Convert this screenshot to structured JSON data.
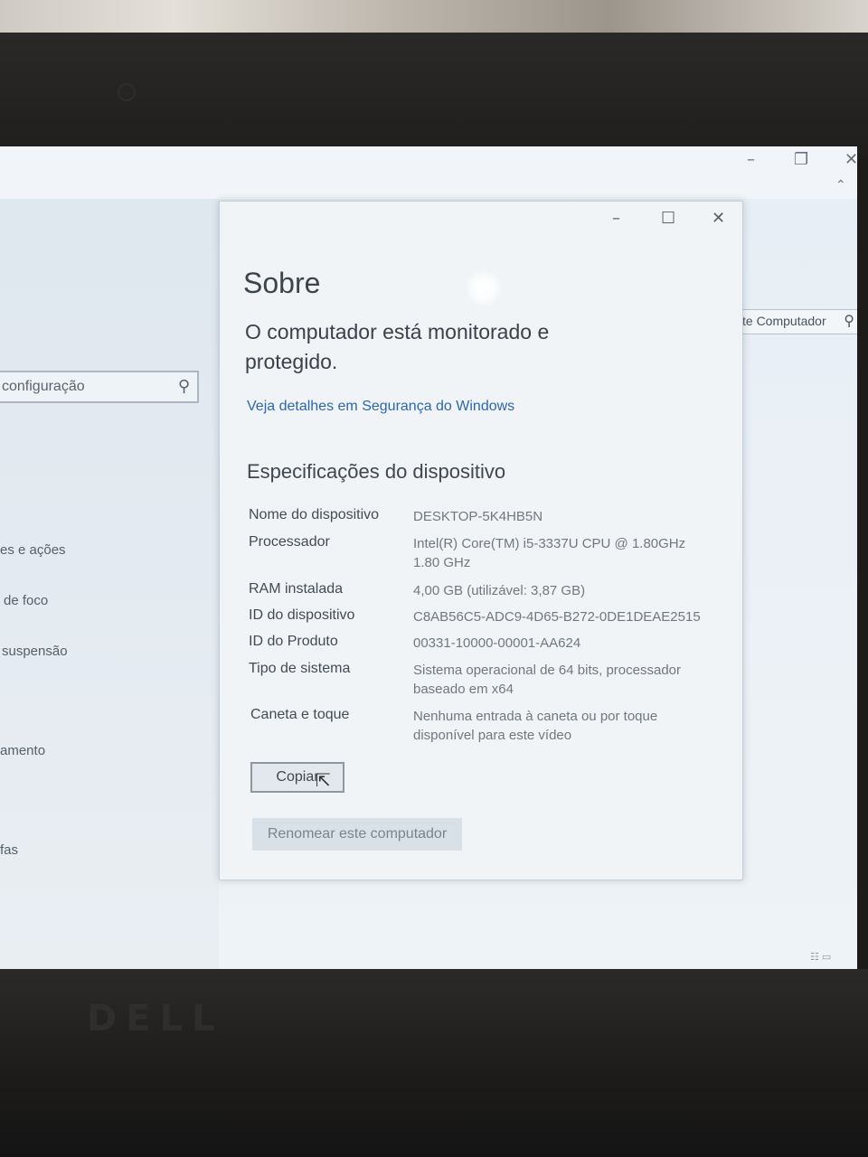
{
  "dialog": {
    "title": "Sobre",
    "protection_status": "O computador está monitorado e protegido.",
    "security_link": "Veja detalhes em Segurança do Windows",
    "section_title": "Especificações do dispositivo",
    "specs": [
      {
        "label": "Nome do dispositivo",
        "value": "DESKTOP-5K4HB5N"
      },
      {
        "label": "Processador",
        "value": "Intel(R) Core(TM) i5-3337U CPU @ 1.80GHz 1.80 GHz"
      },
      {
        "label": "RAM instalada",
        "value": "4,00 GB (utilizável: 3,87 GB)"
      },
      {
        "label": "ID do dispositivo",
        "value": "C8AB56C5-ADC9-4D65-B272-0DE1DEAE2515"
      },
      {
        "label": "ID do Produto",
        "value": "00331-10000-00001-AA624"
      },
      {
        "label": "Tipo de sistema",
        "value": "Sistema operacional de 64 bits, processador baseado em x64"
      },
      {
        "label": "Caneta e toque",
        "value": "Nenhuma entrada à caneta ou por toque disponível para este vídeo"
      }
    ],
    "copy_button": "Copiar",
    "rename_button": "Renomear este computador",
    "controls": {
      "minimize": "–",
      "maximize": "☐",
      "close": "✕"
    }
  },
  "settings_window": {
    "search_placeholder": "configuração",
    "nav_items": [
      "es e ações",
      "de foco",
      "suspensão",
      "amento",
      "fas"
    ],
    "controls": {
      "minimize": "–",
      "restore": "❐",
      "close": "✕"
    }
  },
  "explorer_window": {
    "search_placeholder": "te Computador"
  },
  "hardware": {
    "brand": "DELL"
  }
}
